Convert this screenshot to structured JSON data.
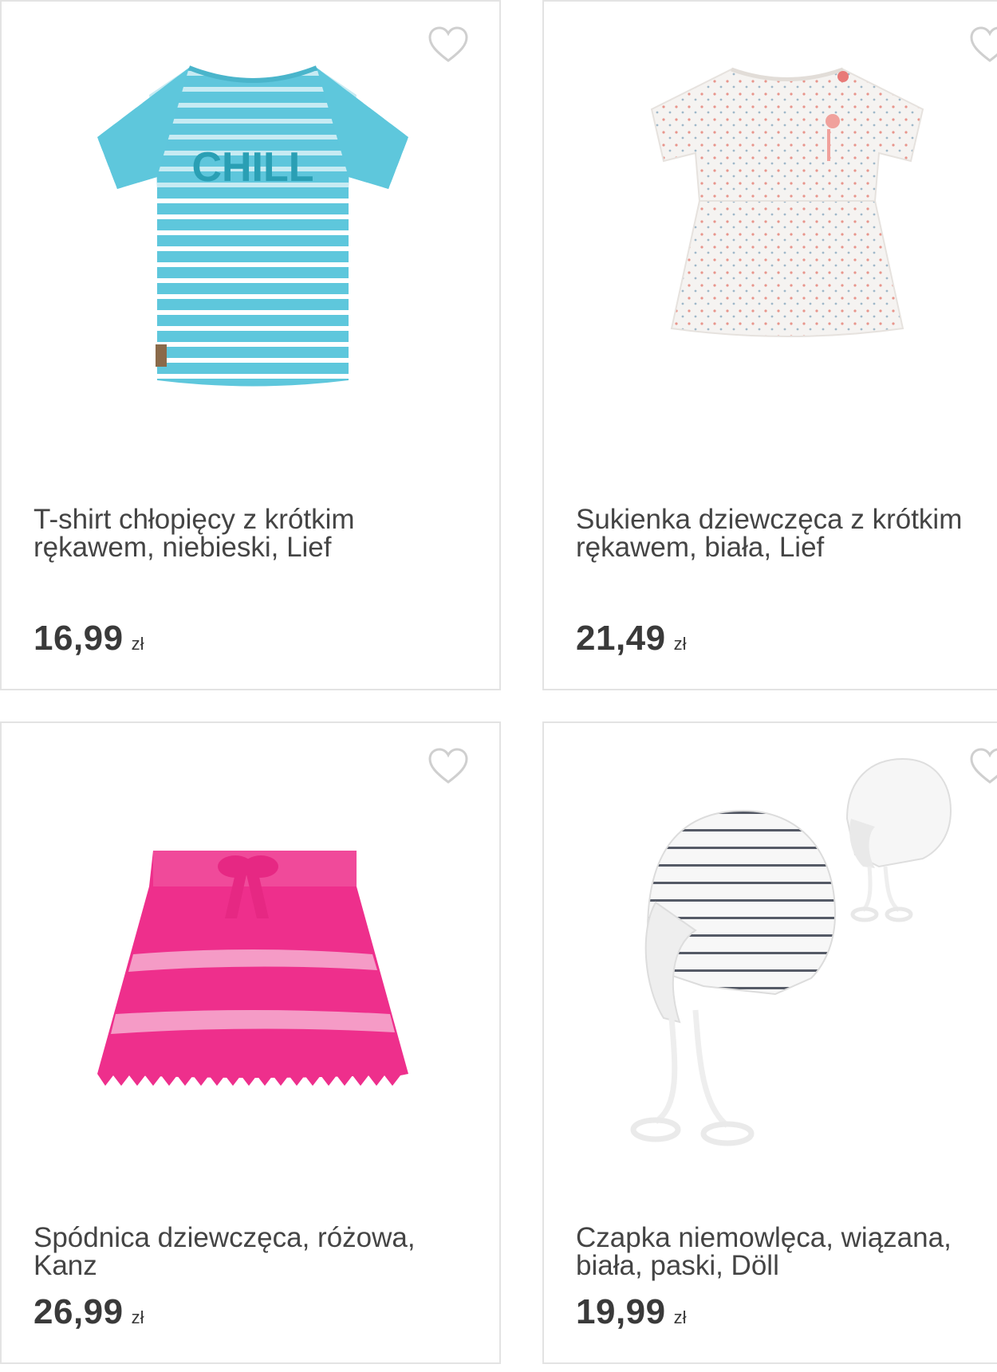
{
  "products": [
    {
      "title": "T-shirt chłopięcy z krótkim rękawem, niebieski, Lief",
      "price": "16,99",
      "currency": "zł",
      "image_text": "CHILL",
      "favorite_icon": "heart-outline-icon",
      "colors": {
        "main": "#5ec7dc",
        "stripe": "#ffffff",
        "print": "#2a9fb4"
      }
    },
    {
      "title": "Sukienka dziewczęca z krótkim rękawem, biała, Lief",
      "price": "21,49",
      "currency": "zł",
      "favorite_icon": "heart-outline-icon",
      "colors": {
        "main": "#f5f3f1",
        "dots": "#e8958c",
        "button": "#e87a78"
      }
    },
    {
      "title": "Spódnica dziewczęca, różowa, Kanz",
      "price": "26,99",
      "currency": "zł",
      "favorite_icon": "heart-outline-icon",
      "colors": {
        "main": "#ee2f8c",
        "light": "#f59bc6"
      }
    },
    {
      "title": "Czapka niemowlęca, wiązana, biała, paski, Döll",
      "price": "19,99",
      "currency": "zł",
      "favorite_icon": "heart-outline-icon",
      "colors": {
        "main": "#f4f4f4",
        "stripe": "#555a66"
      }
    }
  ],
  "theme": {
    "border": "#e3e3e3",
    "text": "#444444",
    "heart": "#cfcfcf"
  }
}
